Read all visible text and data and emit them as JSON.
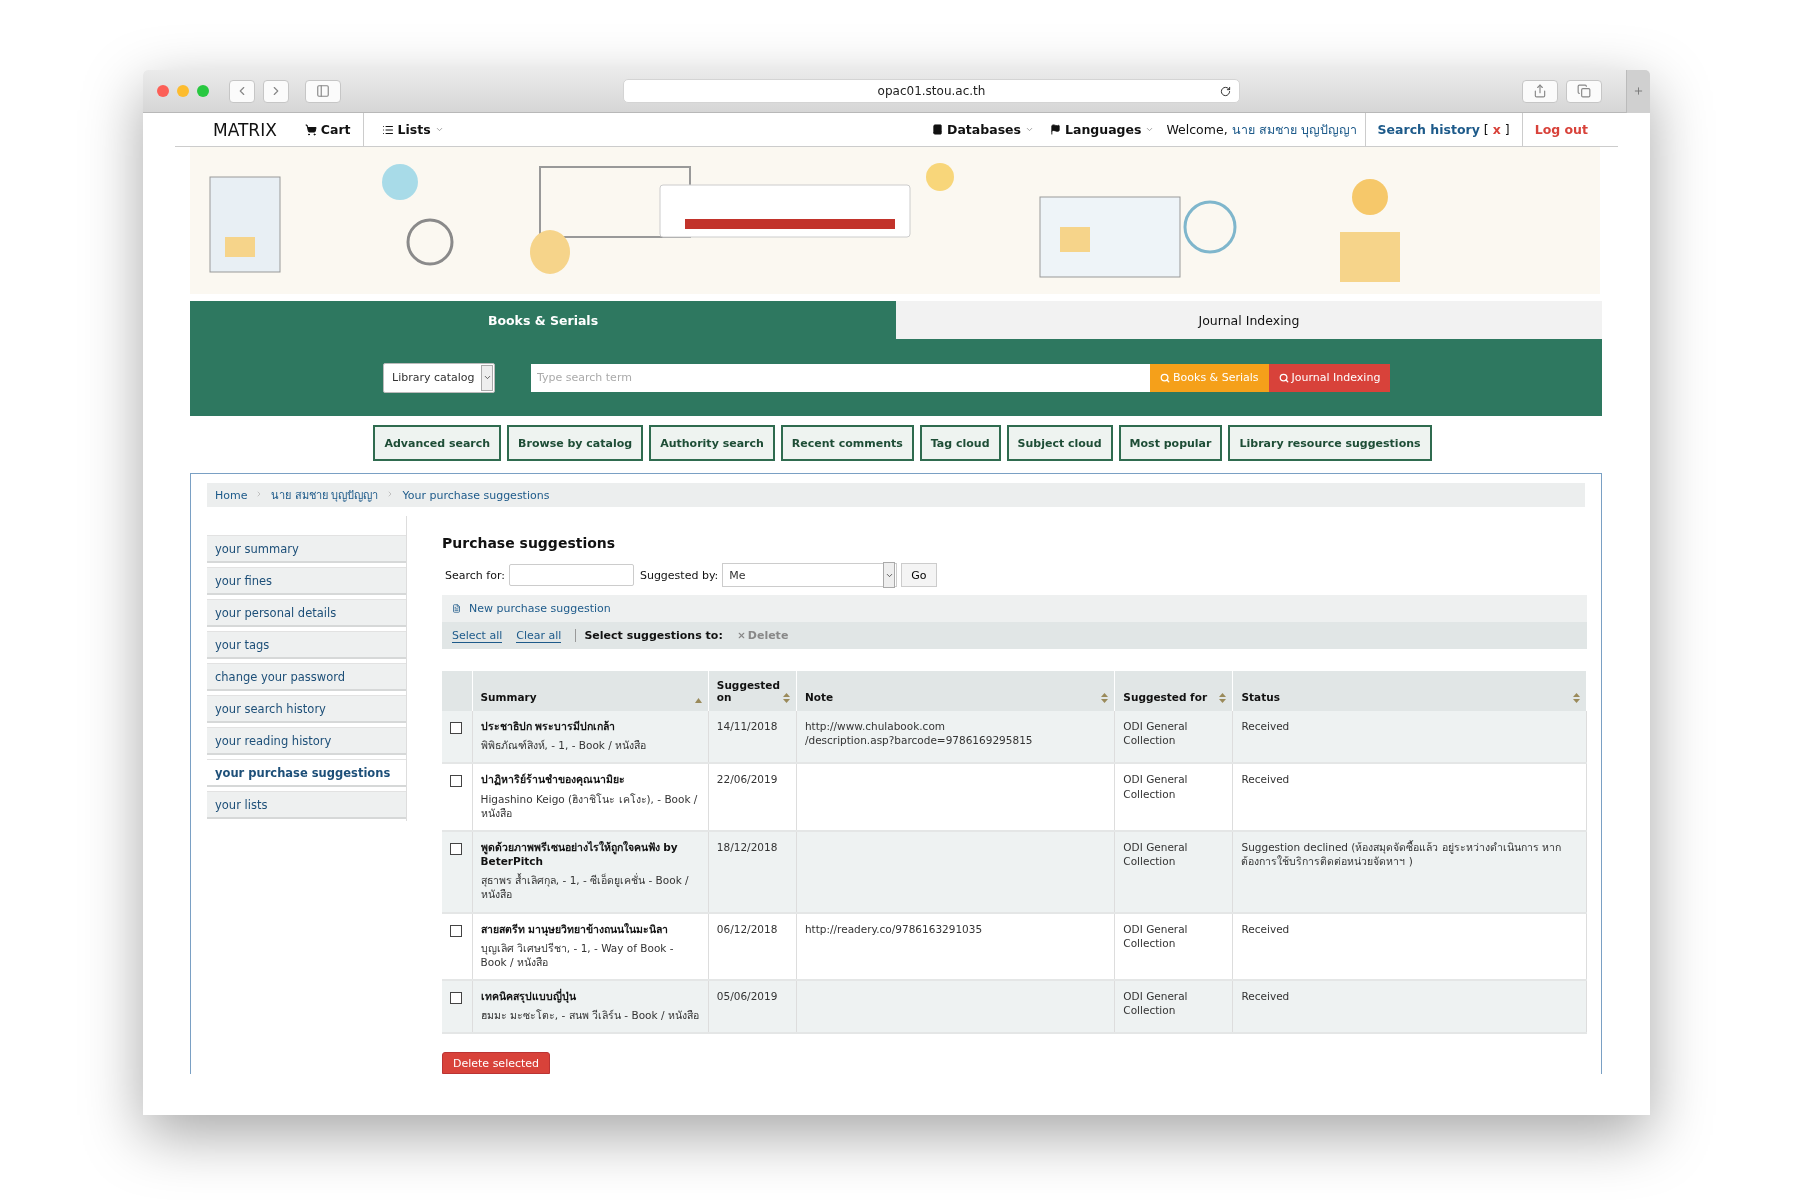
{
  "browser": {
    "url": "opac01.stou.ac.th"
  },
  "navbar": {
    "brand": "MATRIX",
    "cart": "Cart",
    "lists": "Lists",
    "databases": "Databases",
    "languages": "Languages",
    "welcome": "Welcome,",
    "user": "นาย สมชาย บุญปัญญา",
    "search_history": "Search history",
    "open_bracket": "[",
    "clear": "x",
    "close_bracket": "]",
    "logout": "Log out"
  },
  "search_tabs": [
    {
      "label": "Books & Serials",
      "selected": true
    },
    {
      "label": "Journal Indexing",
      "selected": false
    }
  ],
  "search": {
    "catalog_select": "Library catalog",
    "placeholder": "Type search term",
    "buttons": [
      {
        "label": "Books & Serials",
        "kind": "primary"
      },
      {
        "label": "Journal Indexing",
        "kind": "secondary"
      }
    ]
  },
  "nav_links": [
    "Advanced search",
    "Browse by catalog",
    "Authority search",
    "Recent comments",
    "Tag cloud",
    "Subject cloud",
    "Most popular",
    "Library resource suggestions"
  ],
  "breadcrumb": [
    "Home",
    "นาย สมชาย บุญปัญญา",
    "Your purchase suggestions"
  ],
  "sidebar": [
    {
      "label": "your summary",
      "selected": false
    },
    {
      "label": "your fines",
      "selected": false
    },
    {
      "label": "your personal details",
      "selected": false
    },
    {
      "label": "your tags",
      "selected": false
    },
    {
      "label": "change your password",
      "selected": false
    },
    {
      "label": "your search history",
      "selected": false
    },
    {
      "label": "your reading history",
      "selected": false
    },
    {
      "label": "your purchase suggestions",
      "selected": true
    },
    {
      "label": "your lists",
      "selected": false
    }
  ],
  "heading": "Purchase suggestions",
  "filter": {
    "search_label": "Search for:",
    "suggested_by_label": "Suggested by:",
    "suggested_by_value": "Me",
    "go": "Go"
  },
  "new_suggestion": "New purchase suggestion",
  "actions": {
    "select_all": "Select all",
    "clear_all": "Clear all",
    "select_label": "Select suggestions to:",
    "delete": "Delete"
  },
  "table": {
    "columns": [
      {
        "label": "Summary",
        "sorted": true
      },
      {
        "label": "Suggested on",
        "sorted": false
      },
      {
        "label": "Note",
        "sorted": false
      },
      {
        "label": "Suggested for",
        "sorted": false
      },
      {
        "label": "Status",
        "sorted": false
      }
    ],
    "rows": [
      {
        "checked": false,
        "title": "ประชาธิปก พระบารมีปกเกล้า",
        "details": "พิพิธภัณฑ์สิงห์, - 1, - Book / หนังสือ",
        "suggested_on": "14/11/2018",
        "note": "http://www.chulabook.com /description.asp?barcode=9786169295815",
        "suggested_for": "ODI General Collection",
        "status": "Received"
      },
      {
        "checked": false,
        "title": "ปาฏิหาริย์ร้านชำของคุณนามิยะ",
        "details": "Higashino Keigo (ฮิงาชิโนะ เคโงะ), - Book / หนังสือ",
        "suggested_on": "22/06/2019",
        "suggested_for": "ODI General Collection",
        "status": "Received"
      },
      {
        "checked": false,
        "title": "พูดด้วยภาพพรีเซนอย่างไรให้ถูกใจคนฟัง by BeterPitch",
        "details": "สุธาพร ส้ำเลิศกุล, - 1, - ซีเอ็ดยูเคชั่น - Book / หนังสือ",
        "suggested_on": "18/12/2018",
        "suggested_for": "ODI General Collection",
        "status": "Suggestion declined (ห้องสมุดจัดซื้อแล้ว อยู่ระหว่างดำเนินการ หากต้องการใช้บริการติดต่อหน่วยจัดหาฯ )"
      },
      {
        "checked": false,
        "title": "สายสตรีท มานุษยวิทยาข้างถนนในมะนิลา",
        "details": "บุญเลิศ วิเศษปรีชา, - 1, - Way of Book - Book / หนังสือ",
        "suggested_on": "06/12/2018",
        "note": "http://readery.co/9786163291035",
        "suggested_for": "ODI General Collection",
        "status": "Received"
      },
      {
        "checked": false,
        "title": "เทคนิคสรุปแบบญี่ปุ่น",
        "details": "ฮมมะ มะซะโตะ, - สนพ วีเลิร์น - Book / หนังสือ",
        "suggested_on": "05/06/2019",
        "suggested_for": "ODI General Collection",
        "status": "Received"
      }
    ]
  },
  "delete_selected": "Delete selected"
}
